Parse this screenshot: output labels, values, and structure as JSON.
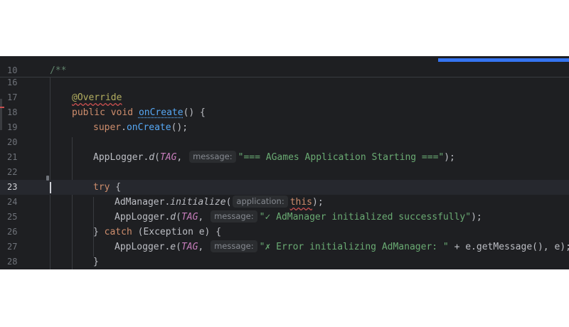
{
  "progress": {
    "fraction": 0.23
  },
  "lines": [
    {
      "num": "10",
      "tokens": {
        "comment": "/**"
      }
    },
    {
      "num": "16"
    },
    {
      "num": "17",
      "tokens": {
        "annotation": "@Override"
      }
    },
    {
      "num": "18",
      "tokens": {
        "kw1": "public",
        "kw2": "void",
        "method": "onCreate",
        "rest": "() {"
      }
    },
    {
      "num": "19",
      "tokens": {
        "kw": "super",
        "dot": ".",
        "call": "onCreate",
        "rest": "();"
      }
    },
    {
      "num": "20"
    },
    {
      "num": "21",
      "tokens": {
        "obj": "AppLogger.",
        "fn": "d",
        "open": "(",
        "const": "TAG",
        "comma": ",",
        "hint": "message:",
        "str": "\"=== AGames Application Starting ===\"",
        "close": ");"
      }
    },
    {
      "num": "22"
    },
    {
      "num": "23",
      "tokens": {
        "kw": "try",
        "rest": " {"
      }
    },
    {
      "num": "24",
      "tokens": {
        "obj": "AdManager.",
        "fn": "initialize",
        "open": "(",
        "hint": "application:",
        "this": "this",
        "close": ");"
      }
    },
    {
      "num": "25",
      "tokens": {
        "obj": "AppLogger.",
        "fn": "d",
        "open": "(",
        "const": "TAG",
        "comma": ",",
        "hint": "message:",
        "str": "\"✓ AdManager initialized successfully\"",
        "close": ");"
      }
    },
    {
      "num": "26",
      "tokens": {
        "brace": "} ",
        "kw": "catch",
        "rest": " (Exception e) {"
      }
    },
    {
      "num": "27",
      "tokens": {
        "obj": "AppLogger.",
        "fn": "e",
        "open": "(",
        "const": "TAG",
        "comma": ",",
        "hint": "message:",
        "str": "\"✗ Error initializing AdManager: \"",
        "close": " + e.getMessage(), e);"
      }
    },
    {
      "num": "28",
      "tokens": {
        "brace": "}"
      }
    }
  ]
}
